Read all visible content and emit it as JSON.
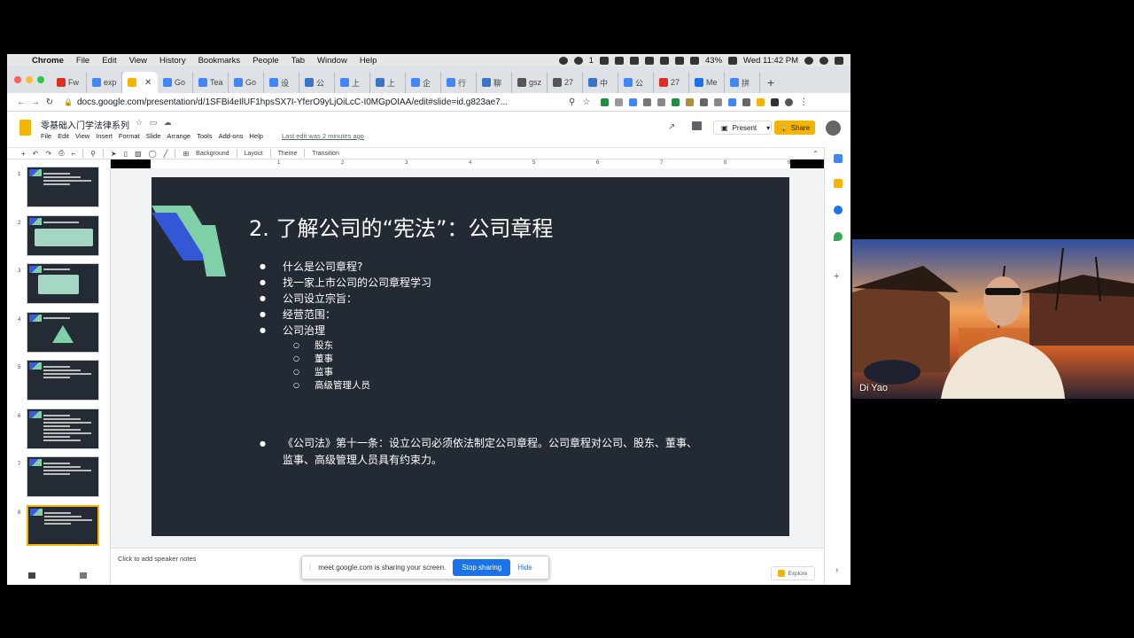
{
  "menubar": {
    "app": "Chrome",
    "items": [
      "File",
      "Edit",
      "View",
      "History",
      "Bookmarks",
      "People",
      "Tab",
      "Window",
      "Help"
    ],
    "wechat_count": "1",
    "battery": "43%",
    "clock": "Wed 11:42 PM"
  },
  "tabs": [
    {
      "label": "Fw",
      "color": "#d93025"
    },
    {
      "label": "exp",
      "color": "#4285f4"
    },
    {
      "label": "",
      "color": "#f4b400",
      "active": true
    },
    {
      "label": "Go",
      "color": "#4285f4"
    },
    {
      "label": "Tea",
      "color": "#4285f4"
    },
    {
      "label": "Go",
      "color": "#4285f4"
    },
    {
      "label": "设",
      "color": "#4285f4"
    },
    {
      "label": "公",
      "color": "#3b73c7"
    },
    {
      "label": "上",
      "color": "#4285f4"
    },
    {
      "label": "上",
      "color": "#3b73c7"
    },
    {
      "label": "企",
      "color": "#4285f4"
    },
    {
      "label": "行",
      "color": "#4285f4"
    },
    {
      "label": "聊",
      "color": "#3b73c7"
    },
    {
      "label": "gsz",
      "color": "#555"
    },
    {
      "label": "27",
      "color": "#555"
    },
    {
      "label": "中",
      "color": "#3b73c7"
    },
    {
      "label": "公",
      "color": "#4285f4"
    },
    {
      "label": "27",
      "color": "#d93025"
    },
    {
      "label": "Me",
      "color": "#1a73e8"
    },
    {
      "label": "拼",
      "color": "#4285f4"
    }
  ],
  "toolbar": {
    "url": "docs.google.com/presentation/d/1SFBi4eIlUF1hpsSX7I-YferO9yLjOiLcC-I0MGpOIAA/edit#slide=id.g823ae7..."
  },
  "docs": {
    "title": "零基础入门学法律系列",
    "menus": [
      "File",
      "Edit",
      "View",
      "Insert",
      "Format",
      "Slide",
      "Arrange",
      "Tools",
      "Add-ons",
      "Help"
    ],
    "last_edit": "Last edit was 2 minutes ago",
    "present_label": "Present",
    "share_label": "Share"
  },
  "edit_toolbar": {
    "background": "Background",
    "layout": "Layout",
    "theme": "Theme",
    "transition": "Transition"
  },
  "ruler_ticks": [
    "1",
    "2",
    "3",
    "4",
    "5",
    "6",
    "7",
    "8",
    "9"
  ],
  "filmstrip": {
    "slides": [
      "1",
      "2",
      "3",
      "4",
      "5",
      "6",
      "7",
      "8"
    ],
    "selected": "8"
  },
  "slide": {
    "title": "2.  了解公司的“宪法”：公司章程",
    "bullets": [
      "什么是公司章程?",
      "找一家上市公司的公司章程学习",
      "公司设立宗旨：",
      "经营范围：",
      "公司治理"
    ],
    "sub_bullets": [
      "股东",
      "董事",
      "监事",
      "高级管理人员"
    ],
    "law_bullet": "《公司法》第十一条：设立公司必须依法制定公司章程。公司章程对公司、股东、董事、监事、高级管理人员具有约束力。"
  },
  "notes": {
    "placeholder": "Click to add speaker notes",
    "explore": "Explore"
  },
  "sharing_bar": {
    "message": "meet.google.com is sharing your screen.",
    "stop": "Stop sharing",
    "hide": "Hide"
  },
  "webcam": {
    "name": "Di Yao"
  }
}
